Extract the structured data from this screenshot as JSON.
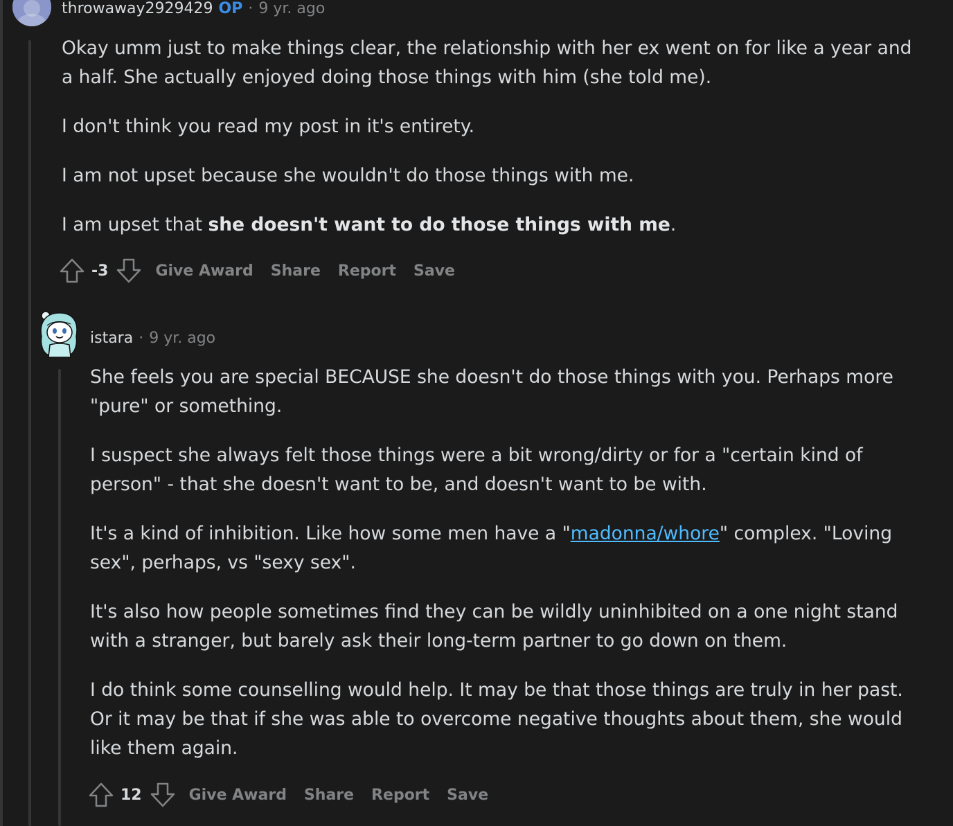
{
  "comments": [
    {
      "author": "throwaway2929429",
      "op_badge": "OP",
      "separator": "·",
      "time": "9 yr. ago",
      "paragraphs": [
        "Okay umm just to make things clear, the relationship with her ex went on for like a year and a half. She actually enjoyed doing those things with him (she told me).",
        "I don't think you read my post in it's entirety.",
        "I am not upset because she wouldn't do those things with me."
      ],
      "p4_prefix": "I am upset that ",
      "p4_bold": "she doesn't want to do those things with me",
      "p4_suffix": ".",
      "score": "-3",
      "actions": {
        "give_award": "Give Award",
        "share": "Share",
        "report": "Report",
        "save": "Save"
      }
    },
    {
      "author": "istara",
      "separator": "·",
      "time": "9 yr. ago",
      "paragraphs": [
        "She feels you are special BECAUSE she doesn't do those things with you. Perhaps more \"pure\" or something.",
        "I suspect she always felt those things were a bit wrong/dirty or for a \"certain kind of person\" - that she doesn't want to be, and doesn't want to be with."
      ],
      "p3_prefix": "It's a kind of inhibition. Like how some men have a \"",
      "p3_link": "madonna/whore",
      "p3_suffix": "\" complex. \"Loving sex\", perhaps, vs \"sexy sex\".",
      "paragraphs_after": [
        "It's also how people sometimes find they can be wildly uninhibited on a one night stand with a stranger, but barely ask their long-term partner to go down on them.",
        "I do think some counselling would help. It may be that those things are truly in her past. Or it may be that if she was able to overcome negative thoughts about them, she would like them again."
      ],
      "score": "12",
      "actions": {
        "give_award": "Give Award",
        "share": "Share",
        "report": "Report",
        "save": "Save"
      }
    }
  ],
  "colors": {
    "background": "#1b1b1c",
    "text": "#d7dadc",
    "muted": "#818384",
    "op_badge": "#3a8ee6",
    "link": "#4fbcff",
    "thread_line": "#343536"
  },
  "icons": {
    "upvote": "arrow-up-outline-icon",
    "downvote": "arrow-down-outline-icon"
  }
}
